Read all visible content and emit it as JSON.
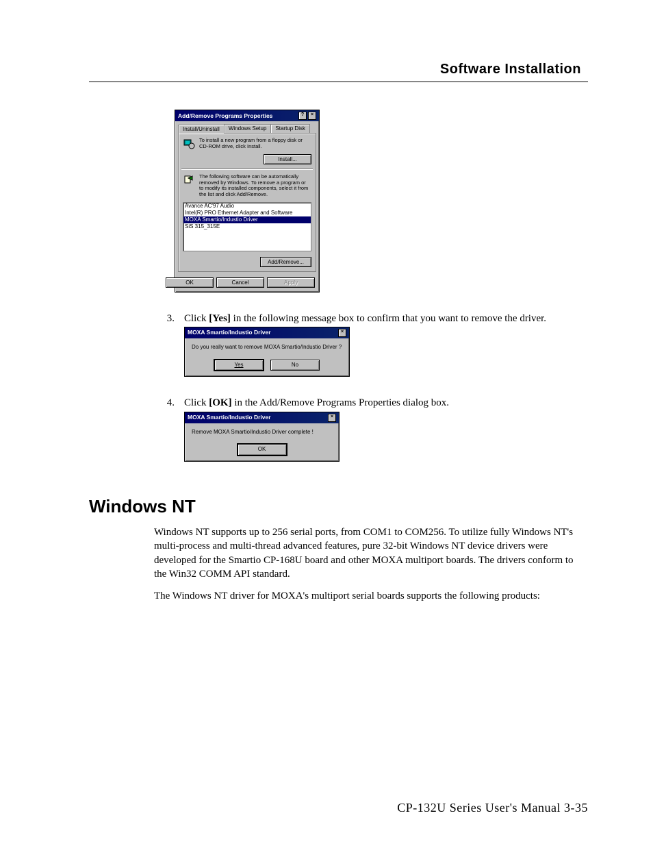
{
  "header": {
    "title": "Software Installation"
  },
  "dialog1": {
    "title": "Add/Remove Programs Properties",
    "help_btn": "?",
    "close_btn": "×",
    "tabs": [
      "Install/Uninstall",
      "Windows Setup",
      "Startup Disk"
    ],
    "install_text": "To install a new program from a floppy disk or CD-ROM drive, click Install.",
    "install_btn": "Install...",
    "remove_text": "The following software can be automatically removed by Windows. To remove a program or to modify its installed components, select it from the list and click Add/Remove.",
    "list": [
      "Avance AC'97 Audio",
      "Intel(R) PRO Ethernet Adapter and Software",
      "MOXA Smartio/Industio Driver",
      "SiS 315_315E"
    ],
    "addremove_btn": "Add/Remove...",
    "ok_btn": "OK",
    "cancel_btn": "Cancel",
    "apply_btn": "Apply"
  },
  "step3": {
    "num": "3.",
    "text_pre": "Click ",
    "bold": "[Yes]",
    "text_post": " in the following message box to confirm that you want to remove the driver."
  },
  "dialog2": {
    "title": "MOXA Smartio/Industio Driver",
    "close_btn": "×",
    "message": "Do you really want to remove MOXA Smartio/Industio Driver ?",
    "yes_btn": "Yes",
    "no_btn": "No"
  },
  "step4": {
    "num": "4.",
    "text_pre": "Click ",
    "bold": "[OK]",
    "text_post": " in the Add/Remove Programs Properties dialog box."
  },
  "dialog3": {
    "title": "MOXA Smartio/Industio Driver",
    "close_btn": "×",
    "message": "Remove MOXA Smartio/Industio Driver complete !",
    "ok_btn": "OK"
  },
  "section": {
    "title": "Windows NT"
  },
  "para1": "Windows NT supports up to 256 serial ports, from COM1 to COM256. To utilize fully Windows NT's multi-process and multi-thread advanced features, pure 32-bit Windows NT device drivers were developed for the Smartio CP-168U board and other MOXA multiport boards. The drivers conform to the Win32 COMM API standard.",
  "para2": "The Windows NT driver for MOXA's multiport serial boards supports the following products:",
  "footer": "CP-132U Series User's Manual 3-35"
}
